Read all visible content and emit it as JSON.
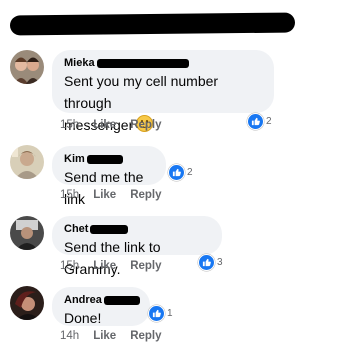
{
  "comments": [
    {
      "author": "Mieka",
      "text_line1": "Sent you my cell number through",
      "text_line2": "messenger",
      "time": "15h",
      "like_label": "Like",
      "reply_label": "Reply",
      "reaction_count": "2"
    },
    {
      "author": "Kim",
      "text": "Send me the link",
      "time": "15h",
      "like_label": "Like",
      "reply_label": "Reply",
      "reaction_count": "2"
    },
    {
      "author": "Chet",
      "text": "Send the link to Grammy.",
      "time": "15h",
      "like_label": "Like",
      "reply_label": "Reply",
      "reaction_count": "3"
    },
    {
      "author": "Andrea",
      "text": "Done!",
      "time": "14h",
      "like_label": "Like",
      "reply_label": "Reply",
      "reaction_count": "1"
    }
  ],
  "colors": {
    "bubble": "#f0f2f5",
    "like_blue": "#1877f2",
    "meta_gray": "#65676b"
  }
}
